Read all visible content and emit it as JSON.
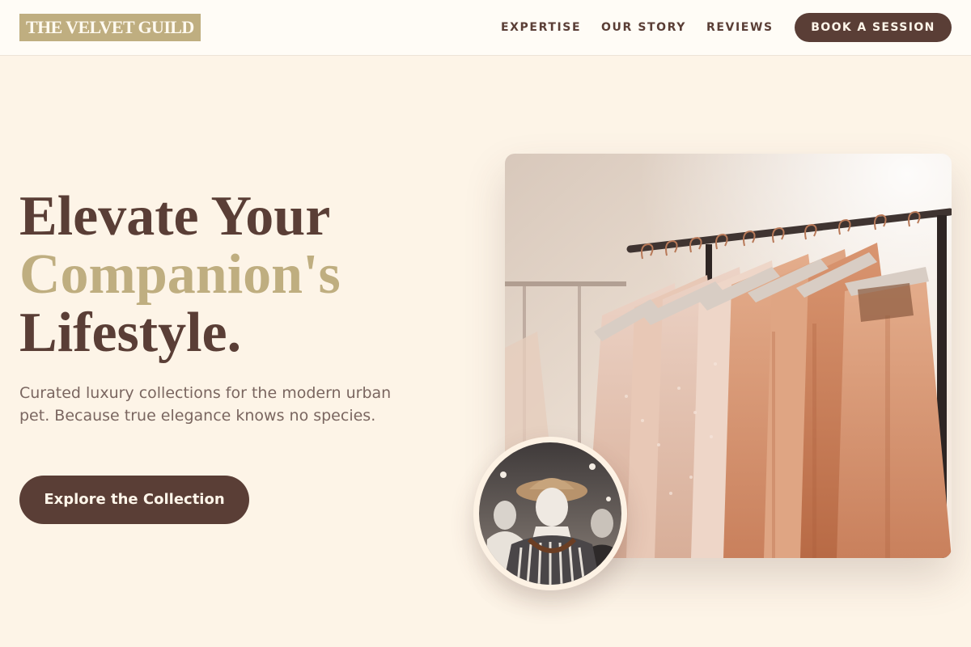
{
  "header": {
    "logo": "THE VELVET GUILD",
    "nav": [
      "EXPERTISE",
      "OUR STORY",
      "REVIEWS"
    ],
    "book_button": "BOOK A SESSION"
  },
  "hero": {
    "headline_line1": "Elevate Your",
    "headline_accent": "Companion's",
    "headline_line3": "Lifestyle.",
    "subcopy": "Curated luxury collections for the modern urban pet. Because true elegance knows no species.",
    "cta": "Explore the Collection"
  },
  "images": {
    "main": "clothing-rack-photo",
    "inset": "mannequin-photo"
  },
  "colors": {
    "brown": "#5a3e36",
    "gold": "#bfae80",
    "cream": "#fdf4e7",
    "header_bg": "#fffcf6"
  }
}
